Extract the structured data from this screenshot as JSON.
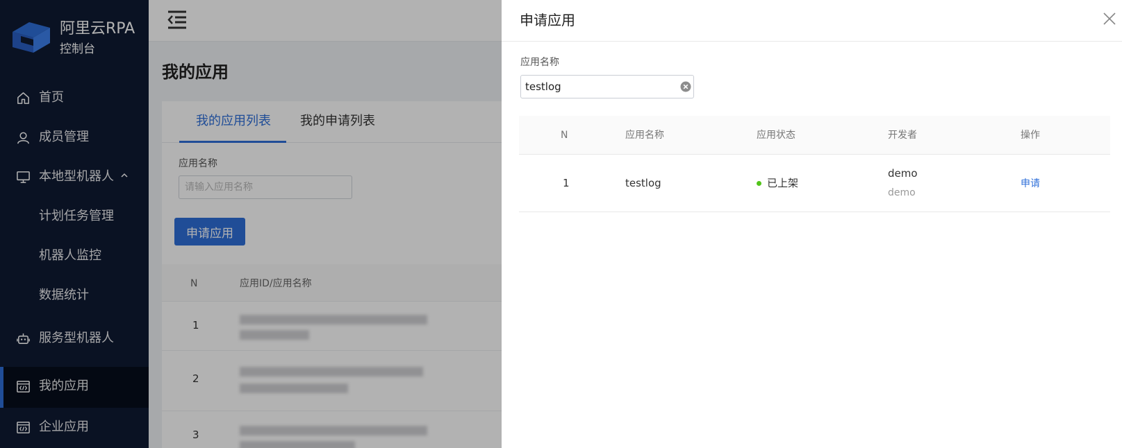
{
  "colors": {
    "sidebar_bg": "#0f1a33",
    "accent": "#2f6fd9",
    "status_online": "#52c41a"
  },
  "brand": {
    "title": "阿里云RPA",
    "subtitle": "控制台"
  },
  "sidebar": {
    "items": [
      {
        "label": "首页",
        "icon": "home-icon"
      },
      {
        "label": "成员管理",
        "icon": "user-icon"
      },
      {
        "label": "本地型机器人",
        "icon": "monitor-icon",
        "expanded": true
      },
      {
        "label": "计划任务管理"
      },
      {
        "label": "机器人监控"
      },
      {
        "label": "数据统计"
      },
      {
        "label": "服务型机器人",
        "icon": "robot-icon"
      },
      {
        "label": "我的应用",
        "icon": "code-icon",
        "active": true
      },
      {
        "label": "企业应用",
        "icon": "code-icon"
      }
    ]
  },
  "page": {
    "title": "我的应用",
    "tabs": [
      {
        "label": "我的应用列表",
        "active": true
      },
      {
        "label": "我的申请列表"
      }
    ],
    "filter_label": "应用名称",
    "filter_placeholder": "请输入应用名称",
    "apply_button": "申请应用",
    "table": {
      "columns": [
        "N",
        "应用ID/应用名称"
      ],
      "rows": [
        {
          "n": "1"
        },
        {
          "n": "2"
        },
        {
          "n": "3"
        }
      ]
    }
  },
  "drawer": {
    "title": "申请应用",
    "filter_label": "应用名称",
    "filter_value": "testlog",
    "table": {
      "columns": [
        "N",
        "应用名称",
        "应用状态",
        "开发者",
        "操作"
      ],
      "rows": [
        {
          "n": "1",
          "name": "testlog",
          "status": "已上架",
          "developer": "demo",
          "developer_sub": "demo",
          "action": "申请"
        }
      ]
    }
  }
}
